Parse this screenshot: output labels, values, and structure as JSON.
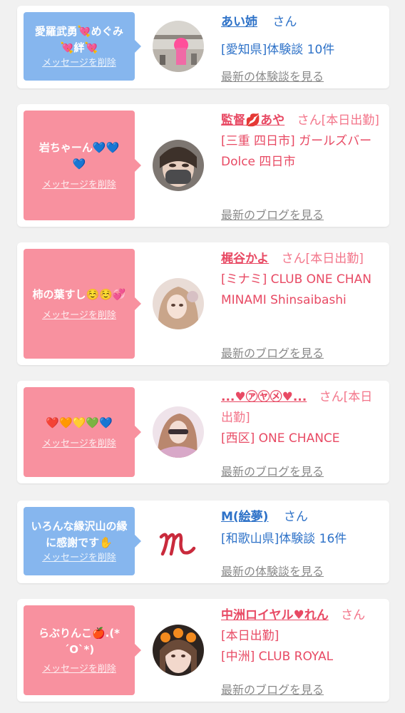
{
  "cards": [
    {
      "bubble_text": "愛羅武勇💘めぐみ💘絆💘",
      "delete_label": "メッセージを削除",
      "name": "あい姉",
      "san": "さん",
      "detail": "[愛知県]体験談 10件",
      "link": "最新の体験談を見る",
      "avatar_icon": "avatar-photo-icon"
    },
    {
      "bubble_text": "岩ちゃーん💙💙💙",
      "delete_label": "メッセージを削除",
      "name": "監督💋あや",
      "san": "さん[本日出勤]",
      "detail": "[三重 四日市] ガールズバー Dolce 四日市",
      "link": "最新のブログを見る",
      "avatar_icon": "avatar-photo-icon"
    },
    {
      "bubble_text": "柿の葉すし☺️☺️💞",
      "delete_label": "メッセージを削除",
      "name": "梶谷かよ",
      "san": "さん[本日出勤]",
      "detail": "[ミナミ] CLUB ONE CHAN MINAMI Shinsaibashi",
      "link": "最新のブログを見る",
      "avatar_icon": "avatar-photo-icon"
    },
    {
      "bubble_text": "❤️🧡💛💚💙",
      "delete_label": "メッセージを削除",
      "name": "...♥㋐㋳㋱♥...",
      "san": "さん[本日出勤]",
      "detail": "[西区] ONE CHANCE",
      "link": "最新のブログを見る",
      "avatar_icon": "avatar-photo-icon"
    },
    {
      "bubble_text": "いろんな縁沢山の縁に感謝です✋",
      "delete_label": "メッセージを削除",
      "name": "M(絵夢)",
      "san": "さん",
      "detail": "[和歌山県]体験談 16件",
      "link": "最新の体験談を見る",
      "avatar_icon": "m-logo-icon"
    },
    {
      "bubble_text": "らぶりんこ🍎.(*´O`*)",
      "delete_label": "メッセージを削除",
      "name": "中洲ロイヤル♥れん",
      "san": "さん",
      "status": "[本日出勤]",
      "detail": "[中洲] CLUB ROYAL",
      "link": "最新のブログを見る",
      "avatar_icon": "avatar-photo-icon"
    }
  ],
  "colors": {
    "blue": "#2e72c8",
    "pink": "#e84a64",
    "bubble_blue": "#86b6ee",
    "bubble_pink": "#f8919f"
  }
}
